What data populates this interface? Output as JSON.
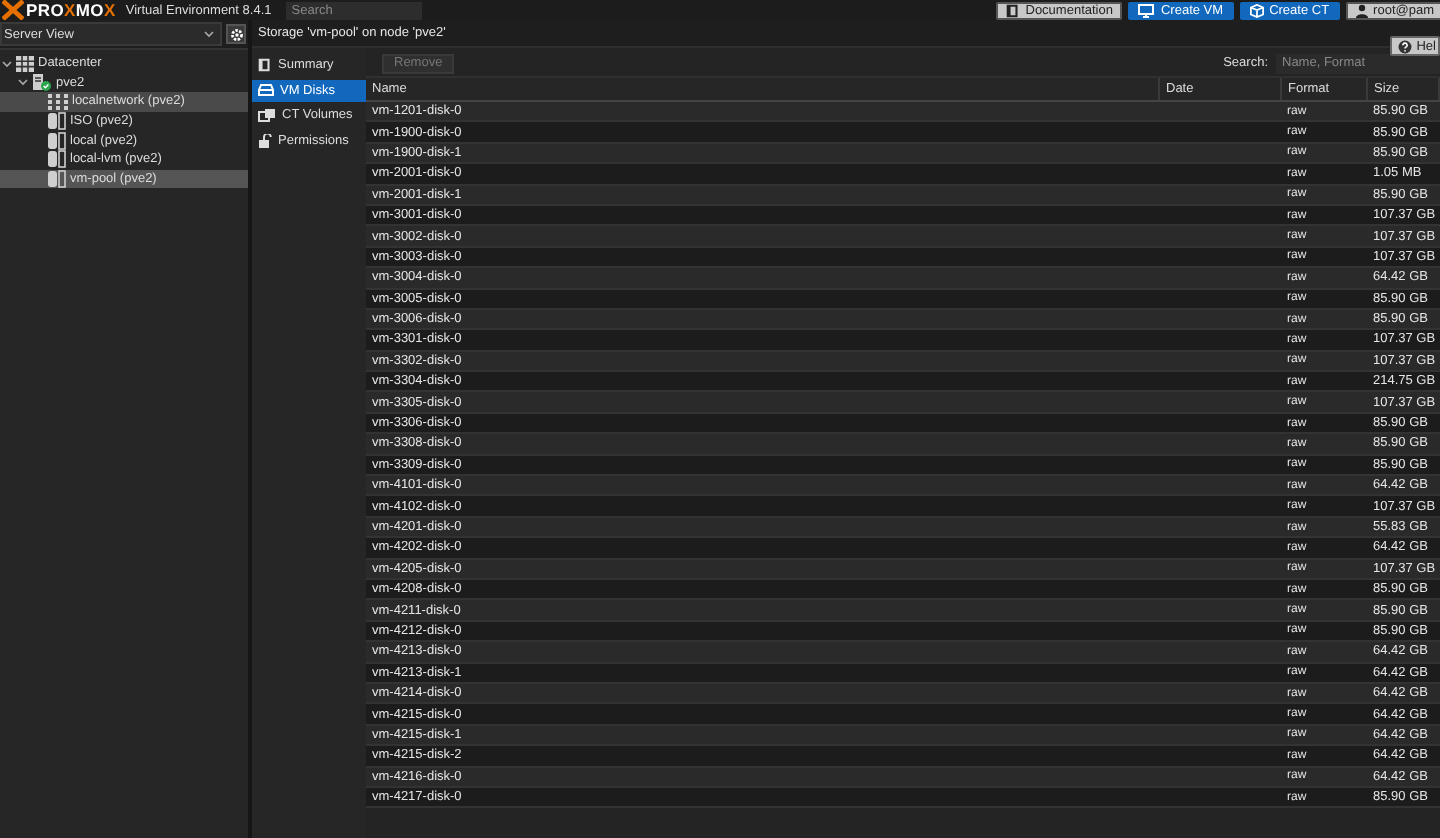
{
  "header": {
    "logo": [
      {
        "text": "PRO",
        "kind": "plain"
      },
      {
        "text": "X",
        "kind": "accent"
      },
      {
        "text": "MO",
        "kind": "plain"
      },
      {
        "text": "X",
        "kind": "accent"
      }
    ],
    "version": "Virtual Environment 8.4.1",
    "search": {
      "placeholder": "Search"
    },
    "buttons": [
      {
        "label": "Documentation",
        "kind": "plain"
      },
      {
        "label": "Create VM",
        "kind": "primary"
      },
      {
        "label": "Create CT",
        "kind": "primary"
      },
      {
        "label": "root@pam",
        "kind": "plain"
      }
    ]
  },
  "sidebar": {
    "view": "Server View",
    "tree": [
      {
        "label": "Datacenter",
        "kind": "datacenter",
        "expanded": true,
        "selected": false,
        "hovered": false,
        "children": [
          {
            "label": "pve2",
            "kind": "node",
            "expanded": true,
            "selected": false,
            "hovered": false,
            "children": [
              {
                "label": "localnetwork (pve2)",
                "kind": "network",
                "selected": false,
                "hovered": true
              },
              {
                "label": "ISO (pve2)",
                "kind": "storage",
                "selected": false,
                "hovered": false
              },
              {
                "label": "local (pve2)",
                "kind": "storage",
                "selected": false,
                "hovered": false
              },
              {
                "label": "local-lvm (pve2)",
                "kind": "storage",
                "selected": false,
                "hovered": false
              },
              {
                "label": "vm-pool (pve2)",
                "kind": "storage",
                "selected": true,
                "hovered": false
              }
            ]
          }
        ]
      }
    ]
  },
  "content": {
    "title": "Storage 'vm-pool' on node 'pve2'",
    "help": "Hel",
    "nav": [
      {
        "label": "Summary",
        "selected": false
      },
      {
        "label": "VM Disks",
        "selected": true
      },
      {
        "label": "CT Volumes",
        "selected": false
      },
      {
        "label": "Permissions",
        "selected": false
      }
    ],
    "toolbar": {
      "remove": {
        "label": "Remove",
        "disabled": true
      },
      "search_label": "Search:",
      "search": {
        "placeholder": "Name, Format"
      }
    },
    "table": {
      "columns": [
        "Name",
        "Date",
        "Format",
        "Size"
      ],
      "rows": [
        [
          "vm-1201-disk-0",
          "",
          "raw",
          "85.90 GB"
        ],
        [
          "vm-1900-disk-0",
          "",
          "raw",
          "85.90 GB"
        ],
        [
          "vm-1900-disk-1",
          "",
          "raw",
          "85.90 GB"
        ],
        [
          "vm-2001-disk-0",
          "",
          "raw",
          "1.05 MB"
        ],
        [
          "vm-2001-disk-1",
          "",
          "raw",
          "85.90 GB"
        ],
        [
          "vm-3001-disk-0",
          "",
          "raw",
          "107.37 GB"
        ],
        [
          "vm-3002-disk-0",
          "",
          "raw",
          "107.37 GB"
        ],
        [
          "vm-3003-disk-0",
          "",
          "raw",
          "107.37 GB"
        ],
        [
          "vm-3004-disk-0",
          "",
          "raw",
          "64.42 GB"
        ],
        [
          "vm-3005-disk-0",
          "",
          "raw",
          "85.90 GB"
        ],
        [
          "vm-3006-disk-0",
          "",
          "raw",
          "85.90 GB"
        ],
        [
          "vm-3301-disk-0",
          "",
          "raw",
          "107.37 GB"
        ],
        [
          "vm-3302-disk-0",
          "",
          "raw",
          "107.37 GB"
        ],
        [
          "vm-3304-disk-0",
          "",
          "raw",
          "214.75 GB"
        ],
        [
          "vm-3305-disk-0",
          "",
          "raw",
          "107.37 GB"
        ],
        [
          "vm-3306-disk-0",
          "",
          "raw",
          "85.90 GB"
        ],
        [
          "vm-3308-disk-0",
          "",
          "raw",
          "85.90 GB"
        ],
        [
          "vm-3309-disk-0",
          "",
          "raw",
          "85.90 GB"
        ],
        [
          "vm-4101-disk-0",
          "",
          "raw",
          "64.42 GB"
        ],
        [
          "vm-4102-disk-0",
          "",
          "raw",
          "107.37 GB"
        ],
        [
          "vm-4201-disk-0",
          "",
          "raw",
          "55.83 GB"
        ],
        [
          "vm-4202-disk-0",
          "",
          "raw",
          "64.42 GB"
        ],
        [
          "vm-4205-disk-0",
          "",
          "raw",
          "107.37 GB"
        ],
        [
          "vm-4208-disk-0",
          "",
          "raw",
          "85.90 GB"
        ],
        [
          "vm-4211-disk-0",
          "",
          "raw",
          "85.90 GB"
        ],
        [
          "vm-4212-disk-0",
          "",
          "raw",
          "85.90 GB"
        ],
        [
          "vm-4213-disk-0",
          "",
          "raw",
          "64.42 GB"
        ],
        [
          "vm-4213-disk-1",
          "",
          "raw",
          "64.42 GB"
        ],
        [
          "vm-4214-disk-0",
          "",
          "raw",
          "64.42 GB"
        ],
        [
          "vm-4215-disk-0",
          "",
          "raw",
          "64.42 GB"
        ],
        [
          "vm-4215-disk-1",
          "",
          "raw",
          "64.42 GB"
        ],
        [
          "vm-4215-disk-2",
          "",
          "raw",
          "64.42 GB"
        ],
        [
          "vm-4216-disk-0",
          "",
          "raw",
          "64.42 GB"
        ],
        [
          "vm-4217-disk-0",
          "",
          "raw",
          "85.90 GB"
        ]
      ]
    }
  }
}
